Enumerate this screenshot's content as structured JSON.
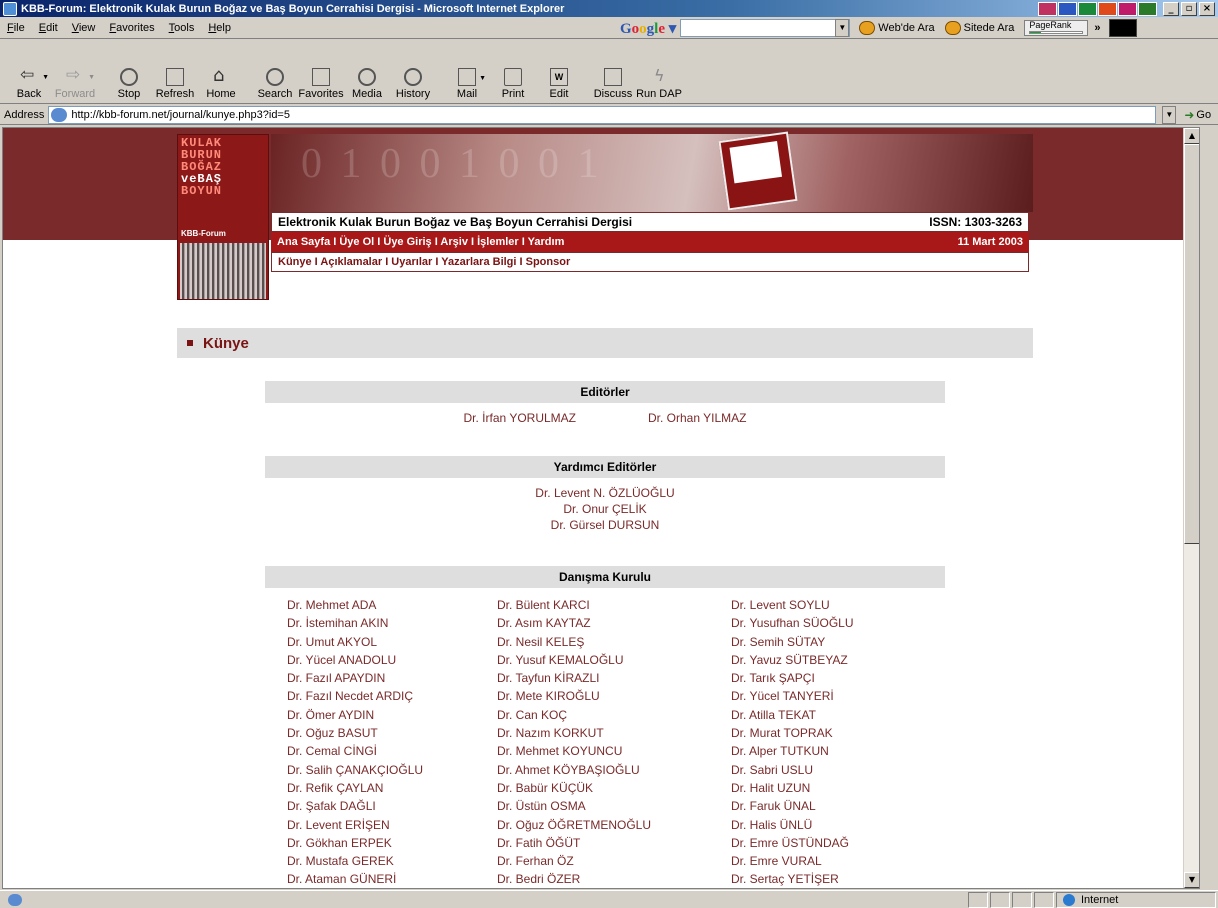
{
  "window": {
    "title": "KBB-Forum: Elektronik Kulak Burun Boğaz ve Baş Boyun Cerrahisi Dergisi - Microsoft Internet Explorer"
  },
  "menu": [
    "File",
    "Edit",
    "View",
    "Favorites",
    "Tools",
    "Help"
  ],
  "google_toolbar": {
    "search_web": "Web'de Ara",
    "search_site": "Sitede Ara",
    "pagerank": "PageRank",
    "pagerank_level": 0.2,
    "more": "»"
  },
  "toolbar": {
    "back": "Back",
    "forward": "Forward",
    "stop": "Stop",
    "refresh": "Refresh",
    "home": "Home",
    "search": "Search",
    "favorites": "Favorites",
    "media": "Media",
    "history": "History",
    "mail": "Mail",
    "print": "Print",
    "edit": "Edit",
    "edit_glyph": "W",
    "discuss": "Discuss",
    "rundap": "Run DAP"
  },
  "address": {
    "label": "Address",
    "url": "http://kbb-forum.net/journal/kunye.php3?id=5",
    "go": "Go"
  },
  "site": {
    "logo_lines": [
      "KULAK",
      "BURUN",
      "BOĞAZ",
      "veBAŞ",
      "BOYUN"
    ],
    "logo_brand": "KBB-Forum",
    "journal_title": "Elektronik Kulak Burun Boğaz ve Baş Boyun Cerrahisi Dergisi",
    "issn": "ISSN: 1303-3263",
    "nav": "Ana Sayfa I Üye Ol I Üye Giriş I Arşiv I İşlemler I Yardım",
    "date": "11 Mart 2003",
    "subnav": "Künye I Açıklamalar I Uyarılar I Yazarlara Bilgi I Sponsor"
  },
  "page": {
    "section_title": "Künye",
    "editors_head": "Editörler",
    "editors": [
      "Dr. İrfan YORULMAZ",
      "Dr. Orhan YILMAZ"
    ],
    "assistant_head": "Yardımcı Editörler",
    "assistants": [
      "Dr. Levent N. ÖZLÜOĞLU",
      "Dr. Onur ÇELİK",
      "Dr. Gürsel DURSUN"
    ],
    "board_head": "Danışma Kurulu",
    "board_col1": [
      "Dr. Mehmet ADA",
      "Dr. İstemihan AKIN",
      "Dr. Umut AKYOL",
      "Dr. Yücel ANADOLU",
      "Dr. Fazıl APAYDIN",
      "Dr. Fazıl Necdet ARDIÇ",
      "Dr. Ömer AYDIN",
      "Dr. Oğuz BASUT",
      "Dr. Cemal CİNGİ",
      "Dr. Salih ÇANAKÇIOĞLU",
      "Dr. Refik ÇAYLAN",
      "Dr. Şafak DAĞLI",
      "Dr. Levent ERİŞEN",
      "Dr. Gökhan ERPEK",
      "Dr. Mustafa GEREK",
      "Dr. Ataman GÜNERİ"
    ],
    "board_col2": [
      "Dr. Bülent KARCI",
      "Dr. Asım KAYTAZ",
      "Dr. Nesil KELEŞ",
      "Dr. Yusuf KEMALOĞLU",
      "Dr. Tayfun KİRAZLI",
      "Dr. Mete KIROĞLU",
      "Dr. Can KOÇ",
      "Dr. Nazım KORKUT",
      "Dr. Mehmet KOYUNCU",
      "Dr. Ahmet KÖYBAŞIOĞLU",
      "Dr. Babür KÜÇÜK",
      "Dr. Üstün OSMA",
      "Dr. Oğuz ÖĞRETMENOĞLU",
      "Dr. Fatih ÖĞÜT",
      "Dr. Ferhan ÖZ",
      "Dr. Bedri ÖZER"
    ],
    "board_col3": [
      "Dr. Levent SOYLU",
      "Dr. Yusufhan SÜOĞLU",
      "Dr. Semih SÜTAY",
      "Dr. Yavuz SÜTBEYAZ",
      "Dr. Tarık ŞAPÇI",
      "Dr. Yücel TANYERİ",
      "Dr. Atilla TEKAT",
      "Dr. Murat TOPRAK",
      "Dr. Alper TUTKUN",
      "Dr. Sabri USLU",
      "Dr. Halit UZUN",
      "Dr. Faruk ÜNAL",
      "Dr. Halis ÜNLÜ",
      "Dr. Emre ÜSTÜNDAĞ",
      "Dr. Emre VURAL",
      "Dr. Sertaç YETİŞER"
    ]
  },
  "status": {
    "zone": "Internet"
  }
}
